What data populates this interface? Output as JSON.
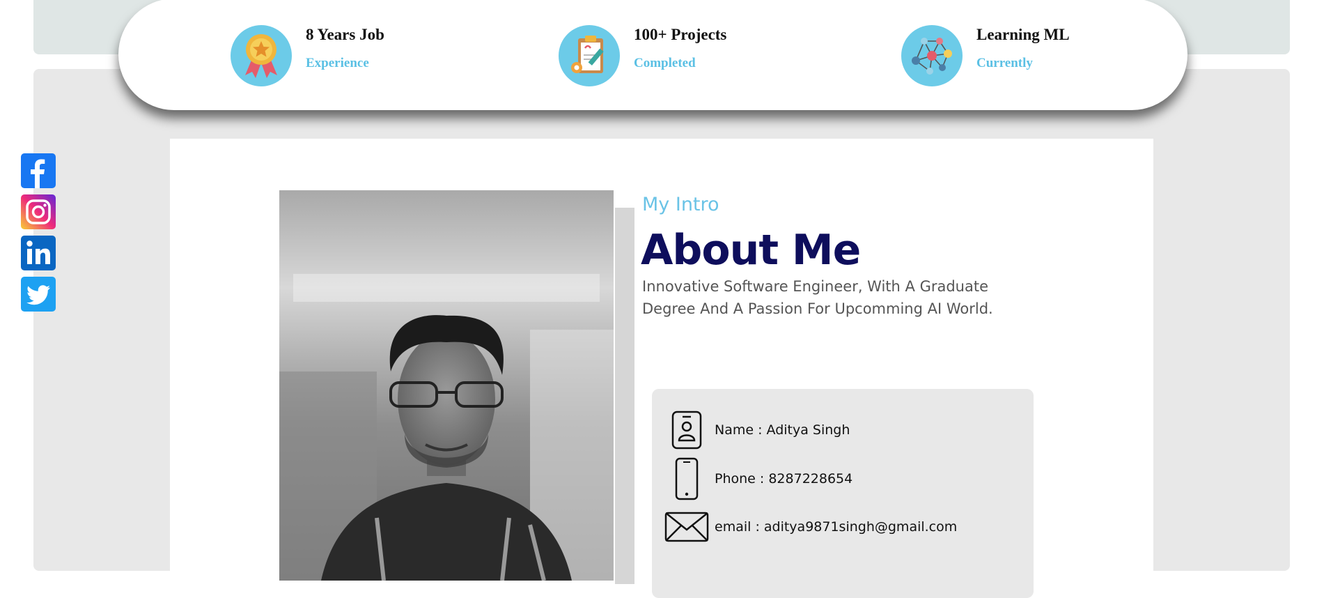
{
  "stats": [
    {
      "title": "8 Years Job",
      "subtitle": "Experience",
      "icon": "medal-icon"
    },
    {
      "title": "100+ Projects",
      "subtitle": "Completed",
      "icon": "clipboard-icon"
    },
    {
      "title": "Learning ML",
      "subtitle": "Currently",
      "icon": "network-icon"
    }
  ],
  "social": [
    "facebook-icon",
    "instagram-icon",
    "linkedin-icon",
    "twitter-icon"
  ],
  "intro": {
    "subtitle": "My Intro",
    "title": "About Me",
    "description": "Innovative Software Engineer, With A Graduate Degree And A Passion For Upcomming AI World."
  },
  "contact": {
    "name": "Name : Aditya Singh",
    "phone": "Phone : 8287228654",
    "email": "email : aditya9871singh@gmail.com"
  },
  "colors": {
    "accent": "#6ccbe8",
    "heading": "#0e0e5c",
    "facebook": "#1877f2",
    "linkedin": "#0a66c2",
    "twitter": "#1da1f2"
  }
}
